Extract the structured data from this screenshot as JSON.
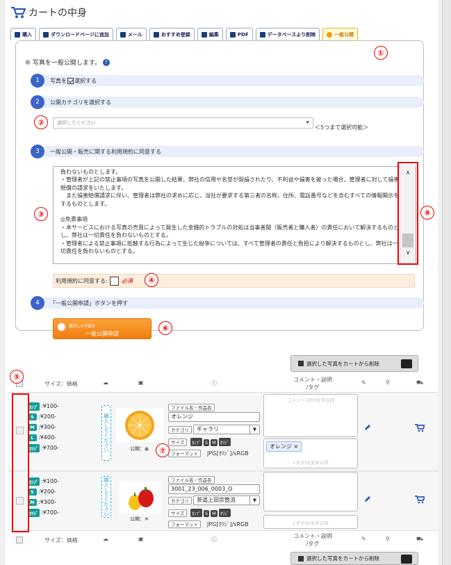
{
  "title": "カートの中身",
  "tabs": [
    {
      "label": "購入",
      "icon": "cart-icon"
    },
    {
      "label": "ダウンロードページに追加",
      "icon": "cloud-download-icon"
    },
    {
      "label": "メール",
      "icon": "mail-icon"
    },
    {
      "label": "おすすめ登録",
      "icon": "star-icon"
    },
    {
      "label": "編集",
      "icon": "pencil-icon"
    },
    {
      "label": "PDF",
      "icon": "pdf-icon"
    },
    {
      "label": "データベースより削除",
      "icon": "trash-icon"
    },
    {
      "label": "一般公開",
      "icon": "globe-icon",
      "active": true
    }
  ],
  "intro": "写真を一般公開します。",
  "steps": {
    "s1_num": "1",
    "s1_pre": "写真を",
    "s1_post": "選択する",
    "s2_num": "2",
    "s2": "公開カテゴリを選択する",
    "s3_num": "3",
    "s3": "一般公開・販売に関する利用規約に同意する",
    "s4_num": "4",
    "s4": "「一般公開申請」ボタンを押す"
  },
  "category_select": {
    "placeholder": "選択してください",
    "note": "＜5つまで選択可能＞"
  },
  "terms_text": "負わないものとします。\n・管理者が上記の禁止事項の写真を公開した結果、弊社の信用や名誉が毀損されたり、不利益や損害を被った場合、管理者に対して損害賠償の請求をいたします。\n　また損害賠償請求に伴い、管理者は弊社の求めに応じ、当社が要求する第三者の名称、住所、電話番号などを含むすべての情報開示をするものとします。\n\n◎免責事項\n・本サービスにおける写真の売買によって発生した金銭的トラブルの対処は当事者間（販売者と購入者）の責任において解決するものとし、弊社は一切責任を負わないものとする。\n・管理者による禁止事項に抵触する行為によって生じた紛争については、すべて管理者の責任と負担により解決するものとし、弊社は一切責任を負わないものとする。",
  "agree": {
    "label": "利用規約に同意する:",
    "required": "必須"
  },
  "publish_button": {
    "line1": "選択した写真を",
    "line2": "一般公開申請"
  },
  "delete_button": "選択した写真をカートから削除",
  "table_header": {
    "size_price": "サイズ：価格",
    "comment": "コメント・説明",
    "tag": "/タグ"
  },
  "annotations": [
    "①",
    "②",
    "③",
    "④",
    "⑤",
    "⑥",
    "⑦",
    "⑧"
  ],
  "rows": [
    {
      "prices": [
        {
          "tag": "ｶﾝﾌﾟ",
          "price": ":¥100-"
        },
        {
          "tag": "S",
          "price": ":¥200-"
        },
        {
          "tag": "M",
          "price": ":¥300-"
        },
        {
          "tag": "L",
          "price": ":¥400-"
        },
        {
          "tag": "ｵﾘｼﾞ",
          "price": ":¥700-"
        }
      ],
      "vertical": "購入してください",
      "public": "公開：",
      "filename_label": "ファイル名・作品名",
      "filename": "オレンジ",
      "category_label": "カテゴリ",
      "category": "ギャラリ",
      "size_label": "サイズ",
      "sizes": [
        "ｶﾝﾌﾟ",
        "S",
        "M",
        "ｵﾘｼﾞ"
      ],
      "format_label": "フォーマット",
      "format": "JPG[ｵﾘｼﾞ]/sRGB",
      "comment_placeholder": "コメント1000文字以内",
      "tag_value": "オレンジ ×",
      "tag_placeholder": "1タグ50文字以内"
    },
    {
      "prices": [
        {
          "tag": "ｶﾝﾌﾟ",
          "price": ":¥100-"
        },
        {
          "tag": "S",
          "price": ":¥200-"
        },
        {
          "tag": "M",
          "price": ":¥300-"
        },
        {
          "tag": "ｵﾘｼﾞ",
          "price": ":¥700-"
        }
      ],
      "vertical": "購入してください",
      "public": "公開：",
      "public_mark": "✖",
      "filename_label": "ファイル名・作品名",
      "filename": "3001_23_006_0003_O",
      "category_label": "カテゴリ",
      "category": "茶道上田宗箇流",
      "size_label": "サイズ",
      "sizes": [
        "ｶﾝﾌﾟ",
        "S",
        "M",
        "ｵﾘｼﾞ"
      ],
      "format_label": "フォーマット",
      "format": "JPG[ｵﾘｼﾞ]/sRGB",
      "tag_placeholder": "1タグ50文字以内"
    }
  ]
}
